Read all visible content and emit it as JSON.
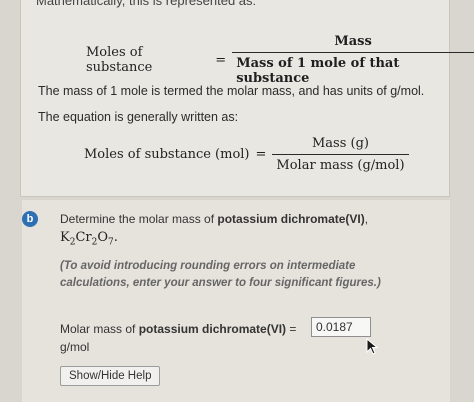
{
  "intro": {
    "cut_line": "Mathematically, this is represented as:",
    "eq1": {
      "lhs": "Moles of substance",
      "eq": "=",
      "num": "Mass",
      "den": "Mass of 1 mole of that substance"
    },
    "para1": "The mass of 1 mole is termed the molar mass, and has units of g/mol.",
    "para2": "The equation is generally written as:",
    "eq2": {
      "lhs": "Moles of substance (mol)",
      "eq": "=",
      "num": "Mass (g)",
      "den": "Molar mass (g/mol)"
    }
  },
  "question": {
    "badge": "b",
    "text_prefix": "Determine the molar mass of ",
    "text_bold": "potassium dichromate(VI)",
    "text_suffix": ",",
    "formula": {
      "k": "K",
      "k_sub": "2",
      "cr": "Cr",
      "cr_sub": "2",
      "o": "O",
      "o_sub": "7",
      "end": "."
    },
    "hint": "(To avoid introducing rounding errors on intermediate calculations, enter your answer to four significant figures.)",
    "answer_prefix": "Molar mass of ",
    "answer_bold": "potassium dichromate(VI)",
    "answer_suffix": " =",
    "answer_value": "0.0187",
    "unit": "g/mol",
    "help_button": "Show/Hide Help"
  }
}
